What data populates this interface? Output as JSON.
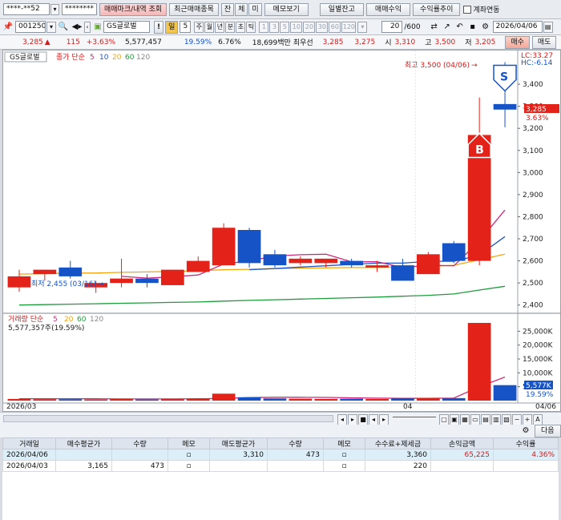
{
  "toolbar": {
    "account_no": "****-**52",
    "password": "********",
    "btn_mark": "매매마크/내역 조회",
    "btn_recent": "최근매매종목",
    "tab_jan": "잔",
    "tab_che": "체",
    "tab_mi": "미",
    "btn_memo": "메모보기",
    "btn_daily": "일별잔고",
    "btn_profit": "매매수익",
    "btn_rate": "수익률추이",
    "link_label": "계좌연동"
  },
  "stock_bar": {
    "code": "001250",
    "name": "GS글로벌",
    "excl": "!",
    "period_label": "일",
    "period_value": "5",
    "period_tabs": [
      "주",
      "월",
      "년",
      "분",
      "초",
      "틱"
    ],
    "intervals": [
      "1",
      "3",
      "5",
      "10",
      "20",
      "30",
      "60",
      "120"
    ],
    "count": "20",
    "count_total": "/600",
    "date": "2026/04/06"
  },
  "quote": {
    "price": "3,285",
    "change_arrow": "▲",
    "change": "115",
    "change_pct": "+3.63%",
    "volume": "5,577,457",
    "turnover_pct": "19.59%",
    "ratio": "6.76%",
    "amount": "18,699백만",
    "pref_label": "최우선",
    "ask": "3,285",
    "bid": "3,275",
    "open_label": "시",
    "open": "3,310",
    "high_label": "고",
    "high": "3,500",
    "low_label": "저",
    "low": "3,205",
    "buy_btn": "매수",
    "sell_btn": "매도"
  },
  "chart": {
    "legend_name": "GS글로벌",
    "legend_ma_label": "종가 단순",
    "legend_ma": [
      "5",
      "10",
      "20",
      "60",
      "120"
    ],
    "lc_label": "LC:33.27",
    "hc_label": "HC:-6.14",
    "high_note": "최고 3,500 (04/06)",
    "low_note": "최저 2,455 (03/16)",
    "price_tag": "3,285",
    "pct_tag": "3.63%",
    "buy_marker": "B",
    "sell_marker": "S",
    "vol_legend_label": "거래량 단순",
    "vol_legend_ma": [
      "5",
      "20",
      "60",
      "120"
    ],
    "vol_info": "5,577,357주(19.59%)",
    "vol_tag": "5,577K",
    "vol_pct_tag": "19.59%",
    "x_label_left": "2026/03",
    "x_label_mid": "04",
    "x_label_right": "04/06"
  },
  "chart_data": {
    "type": "candlestick",
    "y_ticks": [
      "3,400",
      "3,300",
      "3,200",
      "3,100",
      "3,000",
      "2,900",
      "2,800",
      "2,700",
      "2,600",
      "2,500",
      "2,400"
    ],
    "vol_ticks": [
      "25,000K",
      "20,000K",
      "15,000K",
      "10,000K",
      "5,000K"
    ],
    "ylim": [
      2370,
      3480
    ],
    "vol_max": 28000,
    "candles": [
      {
        "o": 2480,
        "h": 2560,
        "l": 2460,
        "c": 2530
      },
      {
        "o": 2540,
        "h": 2560,
        "l": 2510,
        "c": 2560
      },
      {
        "o": 2570,
        "h": 2600,
        "l": 2520,
        "c": 2530
      },
      {
        "o": 2480,
        "h": 2510,
        "l": 2455,
        "c": 2500
      },
      {
        "o": 2500,
        "h": 2610,
        "l": 2480,
        "c": 2520
      },
      {
        "o": 2520,
        "h": 2540,
        "l": 2480,
        "c": 2500
      },
      {
        "o": 2490,
        "h": 2560,
        "l": 2490,
        "c": 2560
      },
      {
        "o": 2550,
        "h": 2620,
        "l": 2550,
        "c": 2600
      },
      {
        "o": 2580,
        "h": 2770,
        "l": 2580,
        "c": 2750
      },
      {
        "o": 2740,
        "h": 2750,
        "l": 2570,
        "c": 2590
      },
      {
        "o": 2630,
        "h": 2650,
        "l": 2570,
        "c": 2580
      },
      {
        "o": 2590,
        "h": 2620,
        "l": 2580,
        "c": 2610
      },
      {
        "o": 2590,
        "h": 2600,
        "l": 2570,
        "c": 2610
      },
      {
        "o": 2600,
        "h": 2610,
        "l": 2570,
        "c": 2580
      },
      {
        "o": 2570,
        "h": 2600,
        "l": 2550,
        "c": 2580
      },
      {
        "o": 2580,
        "h": 2610,
        "l": 2530,
        "c": 2510
      },
      {
        "o": 2540,
        "h": 2640,
        "l": 2540,
        "c": 2630
      },
      {
        "o": 2680,
        "h": 2690,
        "l": 2590,
        "c": 2600
      },
      {
        "o": 2600,
        "h": 3340,
        "l": 2580,
        "c": 3170
      },
      {
        "o": 3310,
        "h": 3500,
        "l": 3205,
        "c": 3285
      }
    ],
    "volumes": [
      600,
      500,
      500,
      400,
      600,
      400,
      500,
      600,
      2500,
      1200,
      800,
      700,
      600,
      700,
      600,
      900,
      1000,
      900,
      28000,
      5577
    ],
    "ma5": [
      null,
      null,
      null,
      null,
      2530,
      2522,
      2528,
      2536,
      2586,
      2600,
      2622,
      2628,
      2630,
      2596,
      2596,
      2570,
      2580,
      2578,
      2690,
      2830
    ],
    "ma10": [
      null,
      null,
      null,
      null,
      null,
      null,
      null,
      null,
      null,
      2560,
      2565,
      2572,
      2578,
      2584,
      2590,
      2590,
      2598,
      2598,
      2626,
      2710
    ],
    "ma20": [
      2540,
      2542,
      2545,
      2545,
      2548,
      2550,
      2552,
      2555,
      2560,
      2562,
      2565,
      2567,
      2568,
      2570,
      2570,
      2572,
      2575,
      2580,
      2605,
      2630
    ],
    "ma60": [
      2400,
      2402,
      2404,
      2406,
      2408,
      2410,
      2412,
      2414,
      2418,
      2421,
      2424,
      2427,
      2430,
      2433,
      2436,
      2440,
      2444,
      2450,
      2468,
      2485
    ],
    "vol_ma5": [
      700,
      700,
      700,
      650,
      620,
      600,
      600,
      650,
      800,
      1100,
      1200,
      1200,
      1150,
      1000,
      900,
      800,
      800,
      900,
      5000,
      8500
    ],
    "markers": [
      {
        "index": 18,
        "label": "B"
      },
      {
        "index": 19,
        "label": "S"
      }
    ],
    "colors": {
      "up": "#e32219",
      "down": "#1553c7",
      "ma5": "#cc2a7a",
      "ma10": "#1f55c8",
      "ma20": "#f3a40f",
      "ma60": "#1e9c3b"
    }
  },
  "bottom": {
    "settings_label": "⚙",
    "next_btn": "다음",
    "headers": [
      "거래일",
      "매수평균가",
      "수량",
      "메모",
      "매도평균가",
      "수량",
      "메모",
      "수수료+제세금",
      "손익금액",
      "수익률"
    ],
    "rows": [
      [
        "2026/04/06",
        "",
        "",
        "▫",
        "3,310",
        "473",
        "▫",
        "3,360",
        "65,225",
        "4.36%"
      ],
      [
        "2026/04/03",
        "3,165",
        "473",
        "▫",
        "",
        "",
        "▫",
        "220",
        "",
        ""
      ]
    ]
  }
}
